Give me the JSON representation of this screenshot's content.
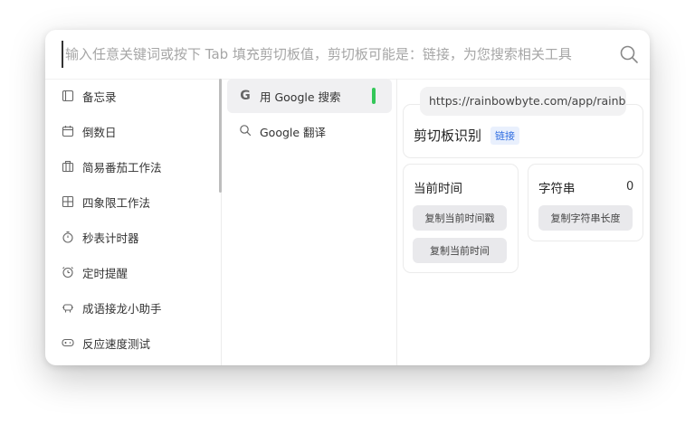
{
  "search": {
    "placeholder": "输入任意关键词或按下 Tab 填充剪切板值，剪切板可能是：链接，为您搜索相关工具"
  },
  "sidebar": {
    "items": [
      {
        "label": "备忘录",
        "icon": "memo-icon"
      },
      {
        "label": "倒数日",
        "icon": "calendar-icon"
      },
      {
        "label": "简易番茄工作法",
        "icon": "briefcase-icon"
      },
      {
        "label": "四象限工作法",
        "icon": "quadrant-icon"
      },
      {
        "label": "秒表计时器",
        "icon": "stopwatch-icon"
      },
      {
        "label": "定时提醒",
        "icon": "alarm-clock-icon"
      },
      {
        "label": "成语接龙小助手",
        "icon": "robot-icon"
      },
      {
        "label": "反应速度测试",
        "icon": "gamepad-icon"
      }
    ]
  },
  "engines": [
    {
      "label": "用 Google 搜索",
      "icon": "google-g-icon",
      "active": true
    },
    {
      "label": "Google 翻译",
      "icon": "search-icon",
      "active": false
    }
  ],
  "clipboard": {
    "url": "https://rainbowbyte.com/app/rainbow",
    "title": "剪切板识别",
    "tag": "链接"
  },
  "time_card": {
    "title": "当前时间",
    "btn_timestamp": "复制当前时间戳",
    "btn_time": "复制当前时间"
  },
  "string_card": {
    "title": "字符串",
    "count": "0",
    "btn_length": "复制字符串长度"
  },
  "colors": {
    "active_indicator": "#34c759",
    "tag_text": "#2f6de1",
    "tag_bg": "#e9f0fd"
  }
}
